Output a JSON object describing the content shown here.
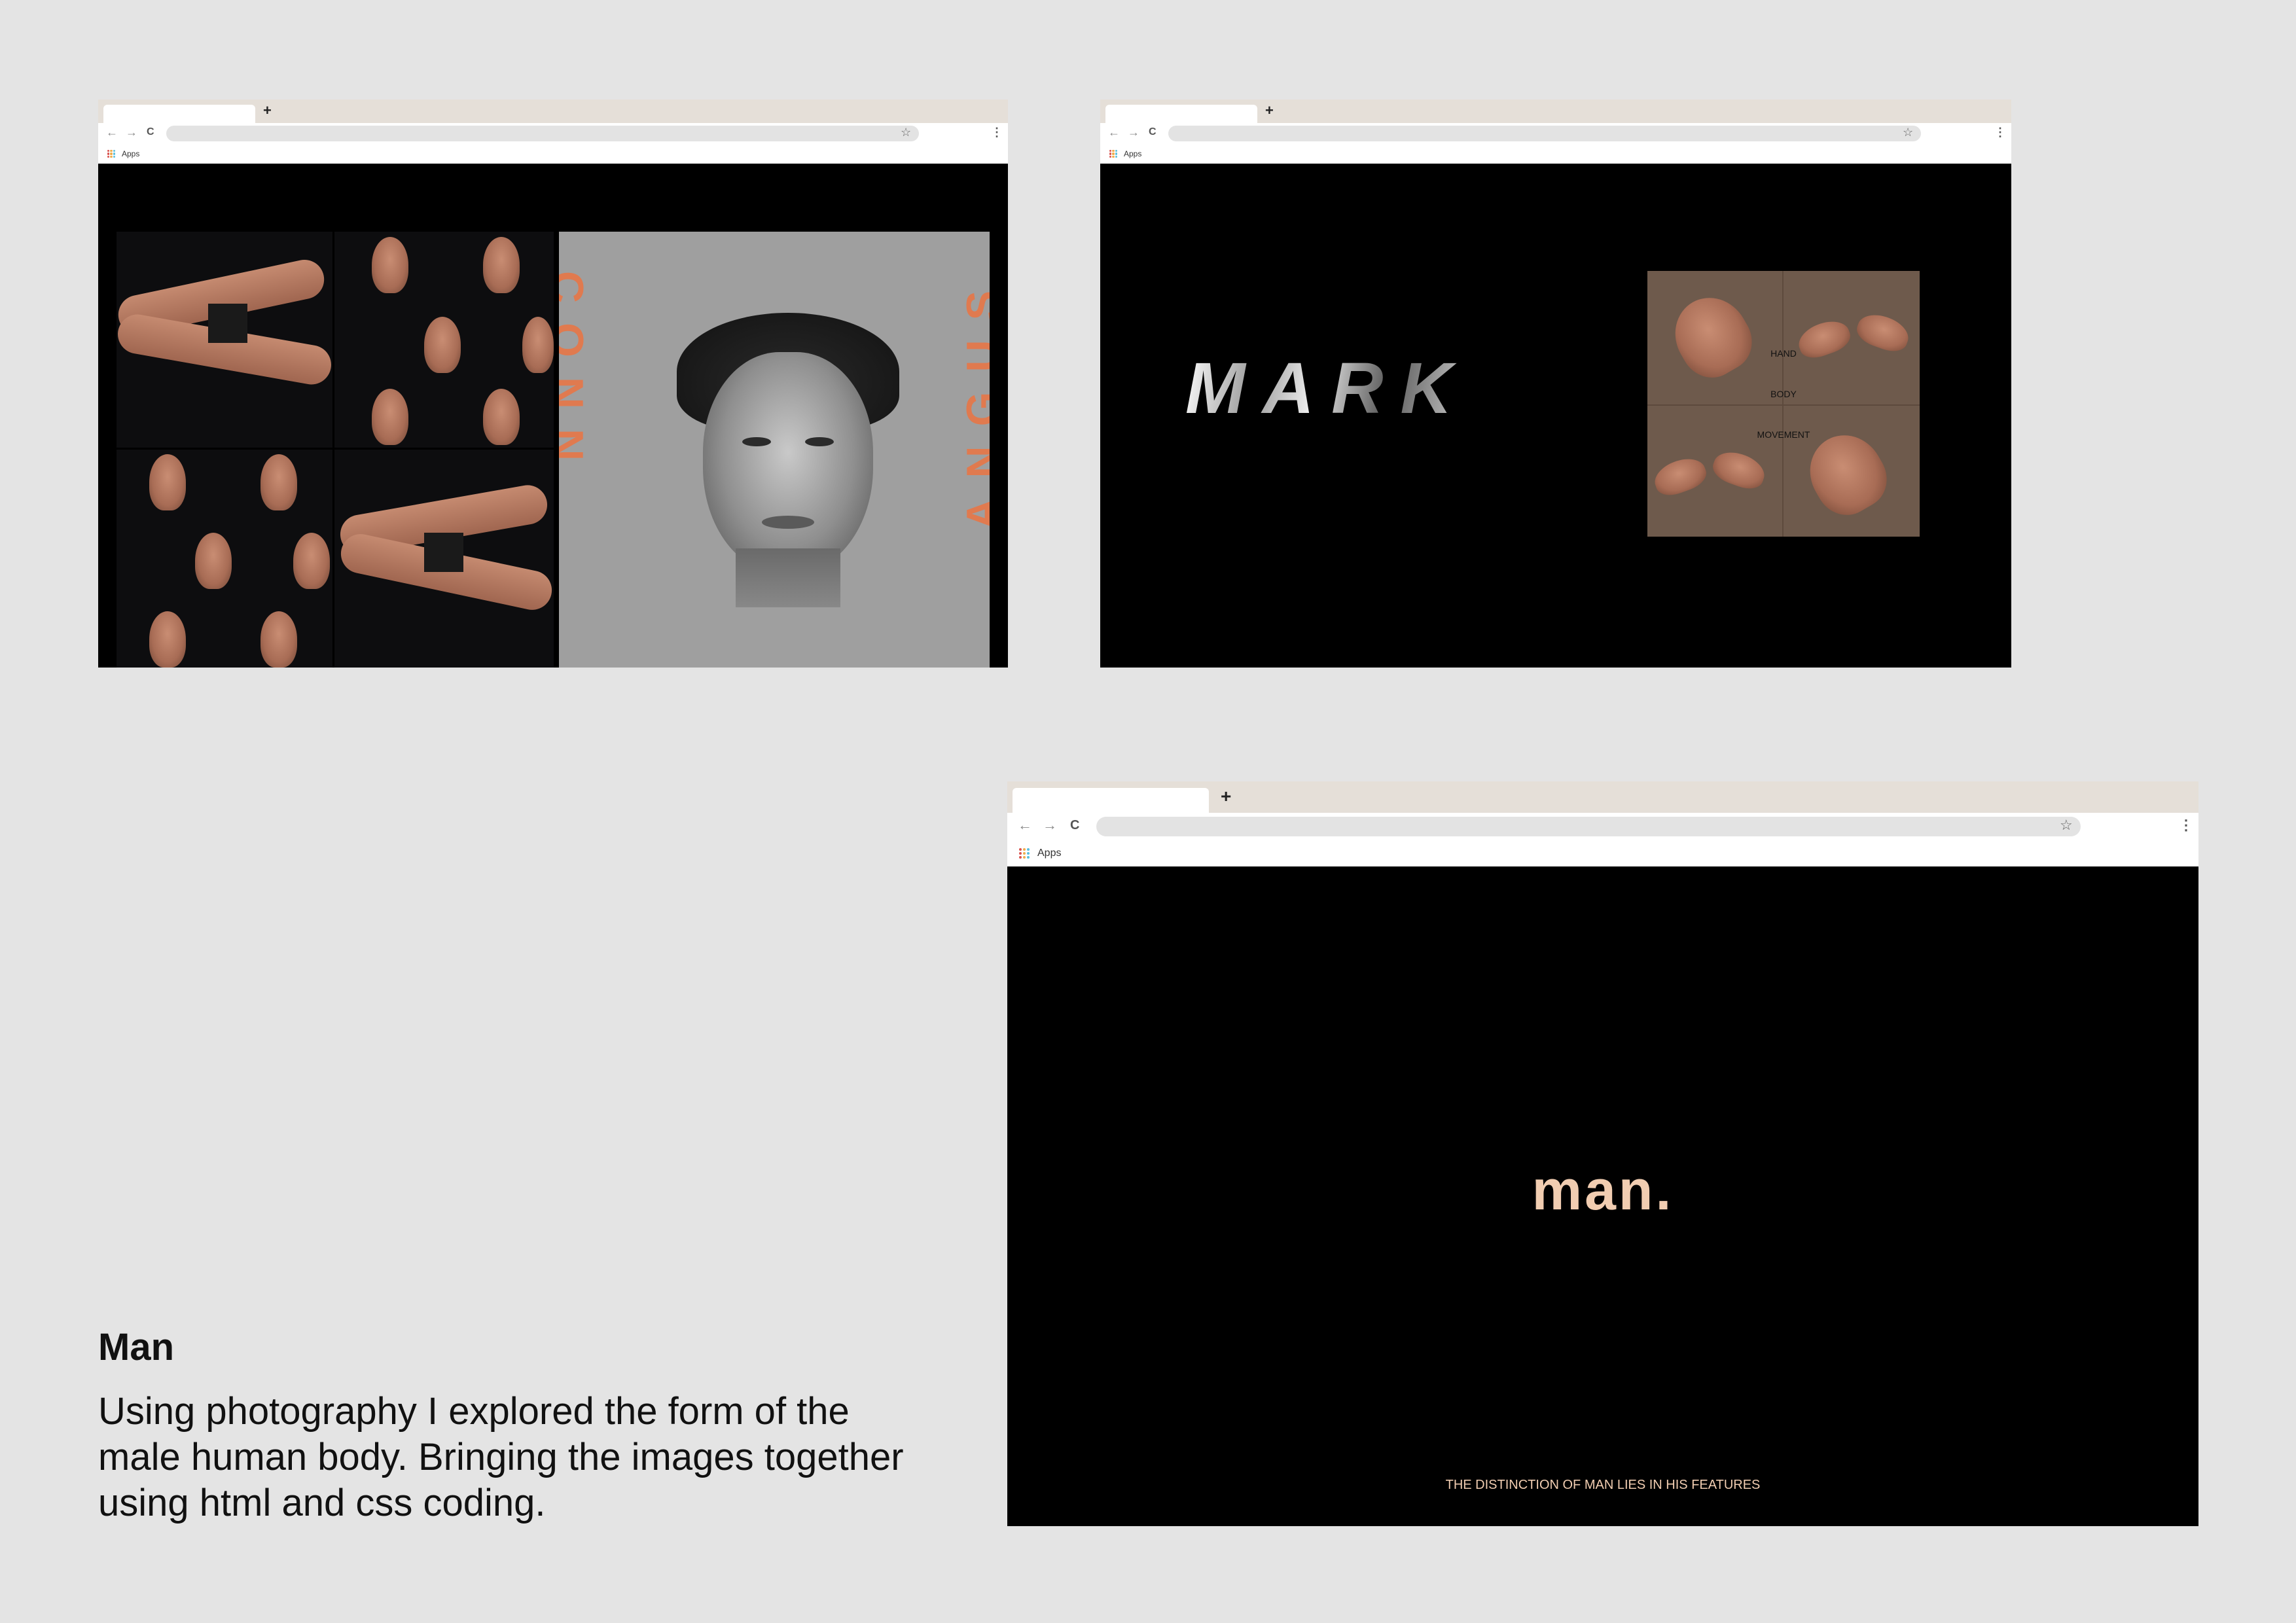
{
  "browser": {
    "new_tab_glyph": "+",
    "star_glyph": "☆",
    "menu_glyph": "⋮",
    "back_glyph": "←",
    "forward_glyph": "→",
    "reload_glyph": "C",
    "apps_label": "Apps"
  },
  "window1": {
    "vertical_text_left": "CONN",
    "vertical_text_right": "ANGUS"
  },
  "window2": {
    "title": "MARK",
    "labels": [
      "HAND",
      "BODY",
      "MOVEMENT"
    ]
  },
  "window3": {
    "title": "man.",
    "tagline": "THE DISTINCTION OF MAN LIES IN HIS FEATURES"
  },
  "caption": {
    "title": "Man",
    "body": "Using photography I explored the form of the male human body. Bringing the images together using html and css coding."
  },
  "colors": {
    "page_bg": "#e4e4e4",
    "accent_orange": "#e07a4f",
    "man_title": "#f1cdb1",
    "tan_panel": "#6e5a4c"
  }
}
